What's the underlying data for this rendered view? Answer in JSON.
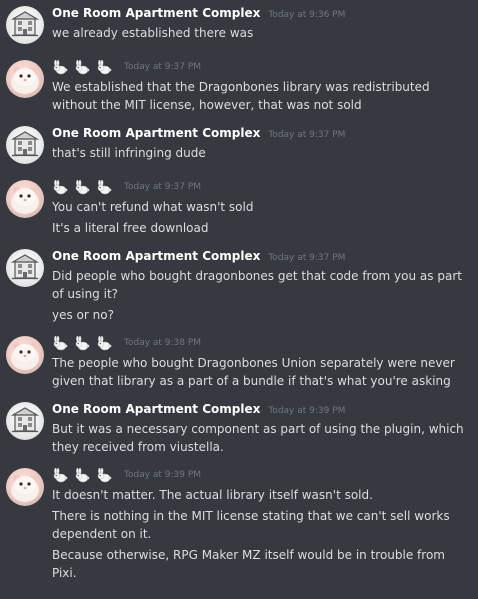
{
  "messages": [
    {
      "author": "One Room Apartment Complex",
      "avatar_icon": "building-avatar-icon",
      "timestamp": "Today at 9:36 PM",
      "lines": [
        "we already established there was"
      ]
    },
    {
      "author": "",
      "author_emoji": [
        "rabbit-emoji",
        "rabbit-emoji",
        "rabbit-emoji"
      ],
      "avatar_icon": "hamster-avatar-icon",
      "timestamp": "Today at 9:37 PM",
      "lines": [
        "We established that the Dragonbones library was redistributed without the MIT license, however, that was not sold"
      ]
    },
    {
      "author": "One Room Apartment Complex",
      "avatar_icon": "building-avatar-icon",
      "timestamp": "Today at 9:37 PM",
      "lines": [
        "that's still infringing dude"
      ]
    },
    {
      "author": "",
      "author_emoji": [
        "rabbit-emoji",
        "rabbit-emoji",
        "rabbit-emoji"
      ],
      "avatar_icon": "hamster-avatar-icon",
      "timestamp": "Today at 9:37 PM",
      "lines": [
        "You can't refund what wasn't sold",
        "It's a literal free download"
      ]
    },
    {
      "author": "One Room Apartment Complex",
      "avatar_icon": "building-avatar-icon",
      "timestamp": "Today at 9:37 PM",
      "lines": [
        "Did people who bought dragonbones get that code from you as part of using it?",
        "yes or no?"
      ]
    },
    {
      "author": "",
      "author_emoji": [
        "rabbit-emoji",
        "rabbit-emoji",
        "rabbit-emoji"
      ],
      "avatar_icon": "hamster-avatar-icon",
      "timestamp": "Today at 9:38 PM",
      "lines": [
        "The people who bought Dragonbones Union separately were never given that library as a part of a bundle if that's what you're asking"
      ]
    },
    {
      "author": "One Room Apartment Complex",
      "avatar_icon": "building-avatar-icon",
      "timestamp": "Today at 9:39 PM",
      "lines": [
        "But it was a necessary component as part of using the plugin, which they received from viustella."
      ]
    },
    {
      "author": "",
      "author_emoji": [
        "rabbit-emoji",
        "rabbit-emoji",
        "rabbit-emoji"
      ],
      "avatar_icon": "hamster-avatar-icon",
      "timestamp": "Today at 9:39 PM",
      "lines": [
        "It doesn't matter. The actual library itself wasn't sold.",
        "There is nothing in the MIT license stating that we can't sell works dependent on it.",
        "Because otherwise, RPG Maker MZ itself would be in trouble from Pixi."
      ]
    }
  ],
  "colors": {
    "background": "#36393f",
    "username": "#ffffff",
    "text": "#dcddde",
    "timestamp": "#72767d"
  }
}
